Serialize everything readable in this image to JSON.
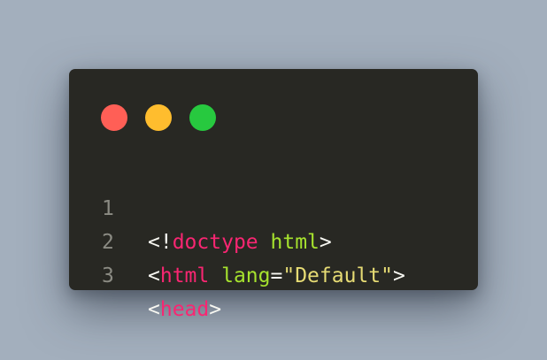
{
  "colors": {
    "background": "#a3afbd",
    "window": "#282823",
    "dot_red": "#ff5f56",
    "dot_yellow": "#ffbd2e",
    "dot_green": "#27c93f",
    "line_number": "#8b8b83",
    "punctuation": "#f8f8f2",
    "tag": "#f92672",
    "attribute": "#a6e22e",
    "string": "#e6db74"
  },
  "window_controls": [
    {
      "name": "close",
      "icon": "red-dot-icon"
    },
    {
      "name": "minimize",
      "icon": "yellow-dot-icon"
    },
    {
      "name": "maximize",
      "icon": "green-dot-icon"
    }
  ],
  "code": {
    "lines": [
      {
        "number": "1",
        "tokens": [
          {
            "text": "<!",
            "kind": "punctuation"
          },
          {
            "text": "doctype",
            "kind": "tag"
          },
          {
            "text": " ",
            "kind": "punctuation"
          },
          {
            "text": "html",
            "kind": "attribute"
          },
          {
            "text": ">",
            "kind": "punctuation"
          }
        ]
      },
      {
        "number": "2",
        "tokens": [
          {
            "text": "<",
            "kind": "punctuation"
          },
          {
            "text": "html",
            "kind": "tag"
          },
          {
            "text": " ",
            "kind": "punctuation"
          },
          {
            "text": "lang",
            "kind": "attribute"
          },
          {
            "text": "=",
            "kind": "punctuation"
          },
          {
            "text": "\"Default\"",
            "kind": "string"
          },
          {
            "text": ">",
            "kind": "punctuation"
          }
        ]
      },
      {
        "number": "3",
        "tokens": [
          {
            "text": "<",
            "kind": "punctuation"
          },
          {
            "text": "head",
            "kind": "tag"
          },
          {
            "text": ">",
            "kind": "punctuation"
          }
        ]
      }
    ]
  }
}
